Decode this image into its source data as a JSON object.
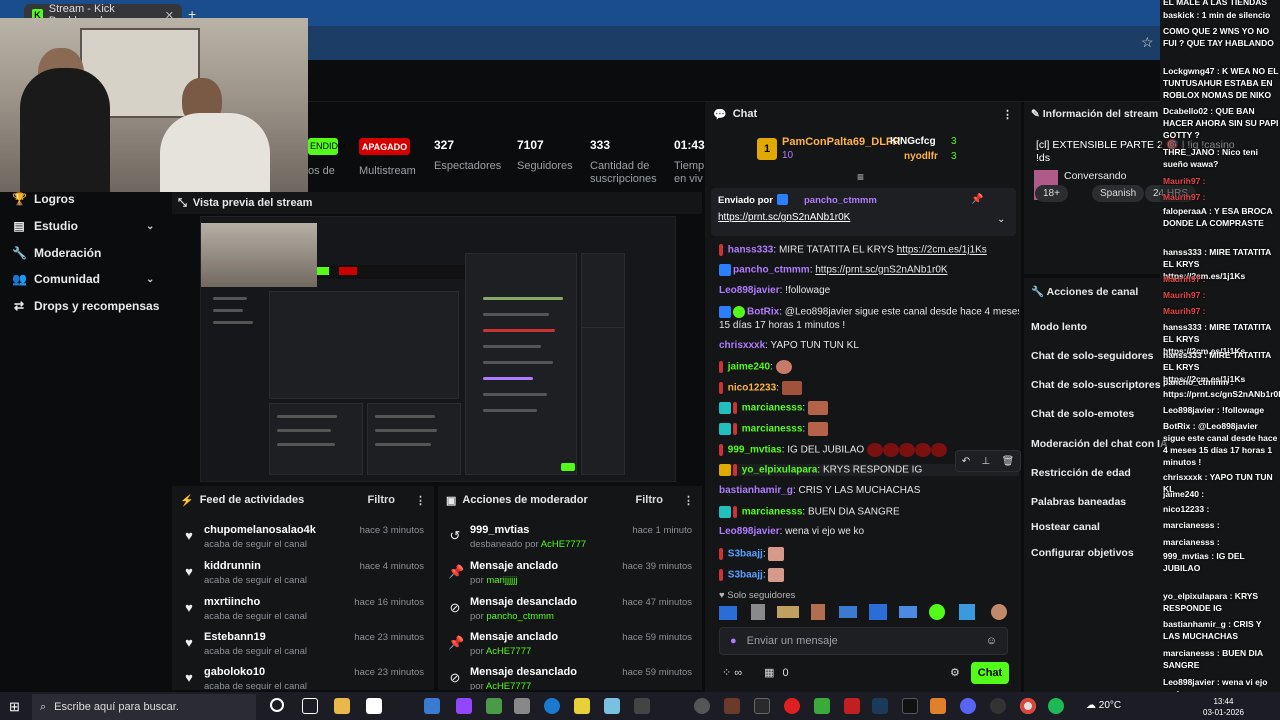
{
  "browser": {
    "tab_title": "Stream - Kick Dashboard",
    "tab_close": "✕",
    "new_tab": "+",
    "favicon": "K"
  },
  "stats": {
    "status_live": "ENDIDO",
    "status_off": "APAGADO",
    "multistream_label": "Multistream",
    "partial_label": "os de",
    "viewers_value": "327",
    "viewers_label": "Espectadores",
    "followers_value": "7107",
    "followers_label": "Seguidores",
    "subs_value": "333",
    "subs_label_1": "Cantidad de",
    "subs_label_2": "suscripciones",
    "time_value": "01:43:",
    "time_label_1": "Tiemp",
    "time_label_2": "en viv"
  },
  "sidebar": {
    "items": [
      {
        "label": "Logros",
        "icon": "trophy-icon"
      },
      {
        "label": "Estudio",
        "icon": "studio-icon"
      },
      {
        "label": "Moderación",
        "icon": "wrench-icon"
      },
      {
        "label": "Comunidad",
        "icon": "community-icon"
      },
      {
        "label": "Drops y recompensas",
        "icon": "drops-icon"
      }
    ]
  },
  "preview": {
    "title": "Vista previa del stream"
  },
  "feed": {
    "title": "Feed de actividades",
    "filter": "Filtro",
    "items": [
      {
        "user": "chupomelanosalao4k",
        "action": "acaba de seguir el canal",
        "time": "hace 3 minutos"
      },
      {
        "user": "kiddrunnin",
        "action": "acaba de seguir el canal",
        "time": "hace 4 minutos"
      },
      {
        "user": "mxrtiincho",
        "action": "acaba de seguir el canal",
        "time": "hace 16 minutos"
      },
      {
        "user": "Estebann19",
        "action": "acaba de seguir el canal",
        "time": "hace 23 minutos"
      },
      {
        "user": "gaboloko10",
        "action": "acaba de seguir el canal",
        "time": "hace 23 minutos"
      }
    ]
  },
  "modactions": {
    "title": "Acciones de moderador",
    "filter": "Filtro",
    "items": [
      {
        "title": "999_mvtias",
        "prefix": "desbaneado por ",
        "by": "AcHE7777",
        "time": "hace 1 minuto"
      },
      {
        "title": "Mensaje anclado",
        "prefix": "por ",
        "by": "marijjjjjj",
        "time": "hace 39 minutos"
      },
      {
        "title": "Mensaje desanclado",
        "prefix": "por ",
        "by": "pancho_ctmmm",
        "time": "hace 47 minutos"
      },
      {
        "title": "Mensaje anclado",
        "prefix": "por ",
        "by": "AcHE7777",
        "time": "hace 59 minutos"
      },
      {
        "title": "Mensaje desanclado",
        "prefix": "por ",
        "by": "AcHE7777",
        "time": "hace 59 minutos"
      }
    ]
  },
  "chat": {
    "title": "Chat",
    "leader1_name": "PamConPalta69_DLFR",
    "leader1_count": "10",
    "leader2_name": "KINGcfcg",
    "leader2_count": "3",
    "leader3_name": "nyodlfr",
    "leader3_count": "3",
    "pinned_label": "Enviado por",
    "pinned_user": "pancho_ctmmm",
    "pinned_link": "https://prnt.sc/gnS2nANb1r0K",
    "messages": [
      {
        "user": "hanss333",
        "color": "#b07cff",
        "text": "MIRE TATATITA EL KRYS ",
        "link": "https://2cm.es/1j1Ks"
      },
      {
        "user": "pancho_ctmmm",
        "color": "#b07cff",
        "text": "",
        "link": "https://prnt.sc/gnS2nANb1r0K"
      },
      {
        "user": "Leo898javier",
        "color": "#b07cff",
        "text": "!followage",
        "link": ""
      },
      {
        "user": "BotRix",
        "color": "#b07cff",
        "text": "@Leo898javier sigue este canal desde hace 4 meses",
        "link": ""
      },
      {
        "user": "",
        "color": "#e6e6e6",
        "text": "15 días 17 horas 1 minutos !",
        "link": ""
      },
      {
        "user": "chrisxxxk",
        "color": "#b07cff",
        "text": "YAPO TUN TUN KL",
        "link": ""
      },
      {
        "user": "jaime240",
        "color": "#53fc18",
        "text": "",
        "link": ""
      },
      {
        "user": "nico12233",
        "color": "#ffb347",
        "text": "",
        "link": ""
      },
      {
        "user": "marcianesss",
        "color": "#53fc18",
        "text": "",
        "link": ""
      },
      {
        "user": "marcianesss",
        "color": "#53fc18",
        "text": "",
        "link": ""
      },
      {
        "user": "999_mvtias",
        "color": "#53fc18",
        "text": "IG DEL JUBILAO",
        "link": ""
      },
      {
        "user": "yo_elpixulapara",
        "color": "#53fc18",
        "text": "KRYS RESPONDE IG",
        "link": ""
      },
      {
        "user": "bastianhamir_g",
        "color": "#b07cff",
        "text": "CRIS Y LAS MUCHACHAS",
        "link": ""
      },
      {
        "user": "marcianesss",
        "color": "#53fc18",
        "text": "BUEN DIA SANGRE",
        "link": ""
      },
      {
        "user": "Leo898javier",
        "color": "#b07cff",
        "text": "wena vi ejo we ko",
        "link": ""
      },
      {
        "user": "S3baajj",
        "color": "#5aa0ff",
        "text": "",
        "link": ""
      },
      {
        "user": "S3baajj",
        "color": "#5aa0ff",
        "text": "",
        "link": ""
      }
    ],
    "solo": "Solo seguidores",
    "input_placeholder": "Enviar un mensaje",
    "send": "Chat",
    "points": "0"
  },
  "info": {
    "title": "Información del stream",
    "stream_title_1": "[cl] EXTENSIBLE PARTE 2 🎯 | !ig !casino",
    "stream_title_2": "!ds",
    "category": "Conversando",
    "tags": [
      "18+",
      "Spanish",
      "24 HRS",
      "DY"
    ]
  },
  "channel_actions": {
    "title": "Acciones de canal",
    "items": [
      "Modo lento",
      "Chat de solo-seguidores",
      "Chat de solo-suscriptores",
      "Chat de solo-emotes",
      "Moderación del chat con IA",
      "Restricción de edad",
      "Palabras baneadas",
      "Hostear canal",
      "Configurar objetivos"
    ]
  },
  "overlay": {
    "lines": [
      [
        "EL MALE A LAS TIENDAS",
        "w"
      ],
      [
        "baskick : 1 min de silencio",
        "w"
      ],
      [
        "COMO QUE 2 WNS YO NO FUI ? QUE TAY HABLANDO",
        "w"
      ],
      [
        "Lockgwng47 : K WEA NO EL TUNTUSAHUR ESTABA EN ROBLOX NOMAS DE NIKO",
        "w"
      ],
      [
        "Dcabello02 : QUE BAN HACER AHORA SIN SU PAPI GOTTY ?",
        "w"
      ],
      [
        "THRE_JANO : Nico teni sueño wawa?",
        "w"
      ],
      [
        "Maurih97 :",
        "c"
      ],
      [
        "Maurih97 :",
        "c"
      ],
      [
        "faloperaaA : Y ESA BROCA DONDE LA COMPRASTE",
        "w"
      ],
      [
        "hanss333 : MIRE TATATITA EL KRYS https://2cm.es/1j1Ks",
        "w"
      ],
      [
        "Maurih97 :",
        "c"
      ],
      [
        "Maurih97 :",
        "c"
      ],
      [
        "Maurih97 :",
        "c"
      ],
      [
        "hanss333 : MIRE TATATITA EL KRYS https://2cm.es/1j1Ks",
        "w"
      ],
      [
        "hanss333 : MIRE TATATITA EL KRYS https://2cm.es/1j1Ks",
        "w"
      ],
      [
        "pancho_ctmmm : https://prnt.sc/gnS2nANb1r0K",
        "w"
      ],
      [
        "Leo898javier : !followage",
        "w"
      ],
      [
        "BotRix : @Leo898javier sigue este canal desde hace 4 meses 15 días 17 horas 1 minutos !",
        "w"
      ],
      [
        "chrisxxxk : YAPO TUN TUN KL",
        "w"
      ],
      [
        "jaime240 :",
        "w"
      ],
      [
        "nico12233 :",
        "w"
      ],
      [
        "marcianesss :",
        "w"
      ],
      [
        "marcianesss :",
        "w"
      ],
      [
        "999_mvtias : IG DEL JUBILAO",
        "w"
      ],
      [
        "yo_elpixulapara : KRYS RESPONDE IG",
        "w"
      ],
      [
        "bastianhamir_g : CRIS Y LAS MUCHACHAS",
        "w"
      ],
      [
        "marcianesss : BUEN DIA SANGRE",
        "w"
      ],
      [
        "Leo898javier : wena vi ejo we ko",
        "w"
      ]
    ]
  },
  "taskbar": {
    "search_placeholder": "Escribe aquí para buscar.",
    "weather": "20°C",
    "time": "13:44",
    "date": "03-01-2026"
  },
  "colors": {
    "kick_green": "#53fc18",
    "red": "#d40000",
    "bg": "#0b0c0e",
    "panel": "#141517"
  }
}
